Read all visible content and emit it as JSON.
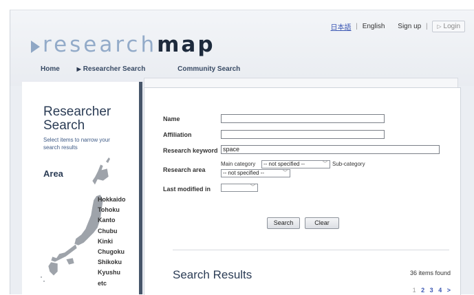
{
  "header": {
    "logo_part1": "research",
    "logo_part2": "map",
    "links": {
      "japanese": "日本語",
      "english": "English",
      "signup": "Sign up",
      "login": "Login"
    },
    "nav": [
      "Home",
      "Researcher Search",
      "Community Search"
    ]
  },
  "sidebar": {
    "title": "Researcher Search",
    "description": "Select items to narrow your search results",
    "area_heading": "Area",
    "regions": [
      "Hokkaido",
      "Tohoku",
      "Kanto",
      "Chubu",
      "Kinki",
      "Chugoku",
      "Shikoku",
      "Kyushu",
      "etc"
    ]
  },
  "form": {
    "name_label": "Name",
    "name_value": "",
    "affiliation_label": "Affiliation",
    "affiliation_value": "",
    "keyword_label": "Research keyword",
    "keyword_value": "space",
    "area_label": "Research area",
    "main_category_label": "Main category",
    "main_category_value": "-- not specified --",
    "sub_category_label": "Sub-category",
    "sub_category_value": "-- not specified --",
    "modified_label": "Last modified in",
    "modified_value": "",
    "search_button": "Search",
    "clear_button": "Clear"
  },
  "results": {
    "title": "Search Results",
    "count": "36 items found",
    "pages": [
      "1",
      "2",
      "3",
      "4",
      ">"
    ]
  }
}
